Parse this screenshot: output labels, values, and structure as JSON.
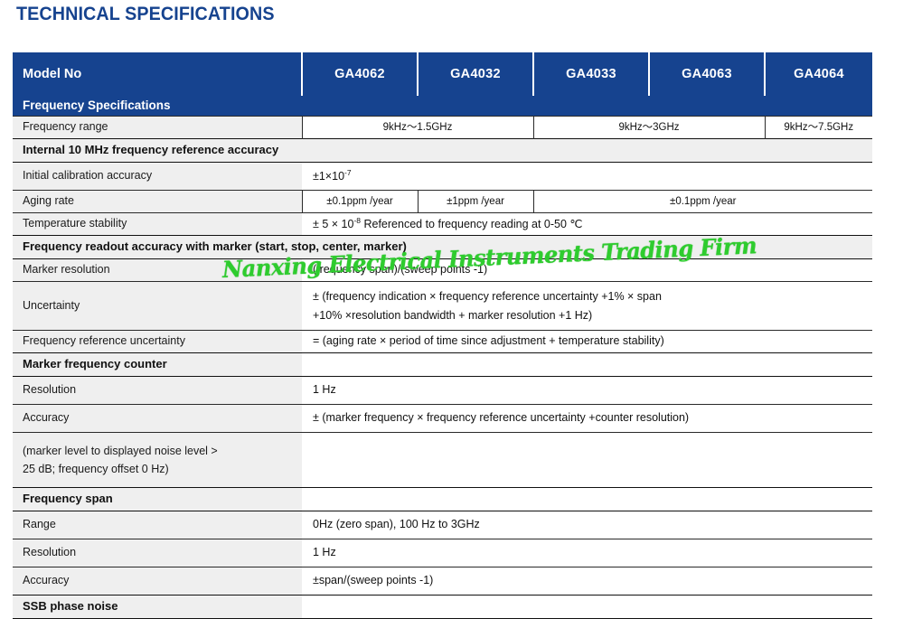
{
  "page": {
    "title": "TECHNICAL SPECIFICATIONS",
    "watermark": "Nanxing Electrical Instruments Trading Firm",
    "accent_color": "#16438f",
    "section_bg": "#efefef",
    "watermark_color": "#2ecc2e"
  },
  "table": {
    "header": {
      "label": "Model No",
      "models": [
        "GA4062",
        "GA4032",
        "GA4033",
        "GA4063",
        "GA4064"
      ]
    },
    "sections": [
      {
        "kind": "blue_band",
        "title": "Frequency Specifications"
      },
      {
        "kind": "row",
        "label": "Frequency range",
        "cells": [
          {
            "text": "9kHz～1.5GHz",
            "span": 2
          },
          {
            "text": "9kHz～3GHz",
            "span": 2
          },
          {
            "text": "9kHz～7.5GHz",
            "span": 1
          }
        ]
      },
      {
        "kind": "gray_band",
        "title": "Internal 10 MHz frequency reference accuracy"
      },
      {
        "kind": "row",
        "label": "Initial calibration accuracy",
        "value": "±1×10",
        "value_sup": "-7"
      },
      {
        "kind": "row",
        "label": "Aging rate",
        "cells": [
          {
            "text": "±0.1ppm /year",
            "span": 1
          },
          {
            "text": "±1ppm /year",
            "span": 1
          },
          {
            "text": "±0.1ppm /year",
            "span": 3
          }
        ]
      },
      {
        "kind": "row",
        "label": "Temperature stability",
        "value_pre": "± 5 × 10",
        "value_sup": "-8",
        "value_post": " Referenced to frequency reading at 0-50 ℃"
      },
      {
        "kind": "gray_band",
        "title": "Frequency readout accuracy with marker (start, stop, center, marker)"
      },
      {
        "kind": "row",
        "label": "Marker resolution",
        "value": "(frequency span)/(sweep points -1)"
      },
      {
        "kind": "row",
        "label": "Uncertainty",
        "value_line1": "± (frequency indication × frequency reference uncertainty +1% × span",
        "value_line2": "+10% ×resolution bandwidth + marker resolution +1 Hz)"
      },
      {
        "kind": "row",
        "label": "Frequency reference uncertainty",
        "value": "= (aging rate × period of time since adjustment + temperature stability)"
      },
      {
        "kind": "gray_band",
        "title": "Marker frequency counter"
      },
      {
        "kind": "row",
        "label": "Resolution",
        "value": "1 Hz"
      },
      {
        "kind": "row",
        "label": "Accuracy",
        "value": "± (marker frequency × frequency reference uncertainty +counter resolution)"
      },
      {
        "kind": "row",
        "label_line1": "(marker level to displayed noise level >",
        "label_line2": "25 dB; frequency offset 0 Hz)",
        "value": ""
      },
      {
        "kind": "gray_band",
        "title": "Frequency span"
      },
      {
        "kind": "row",
        "label": "Range",
        "value": "0Hz (zero span), 100 Hz to 3GHz"
      },
      {
        "kind": "row",
        "label": "Resolution",
        "value": "1 Hz"
      },
      {
        "kind": "row",
        "label": "Accuracy",
        "value": "±span/(sweep points -1)"
      },
      {
        "kind": "gray_band",
        "title": "SSB phase noise"
      }
    ]
  }
}
